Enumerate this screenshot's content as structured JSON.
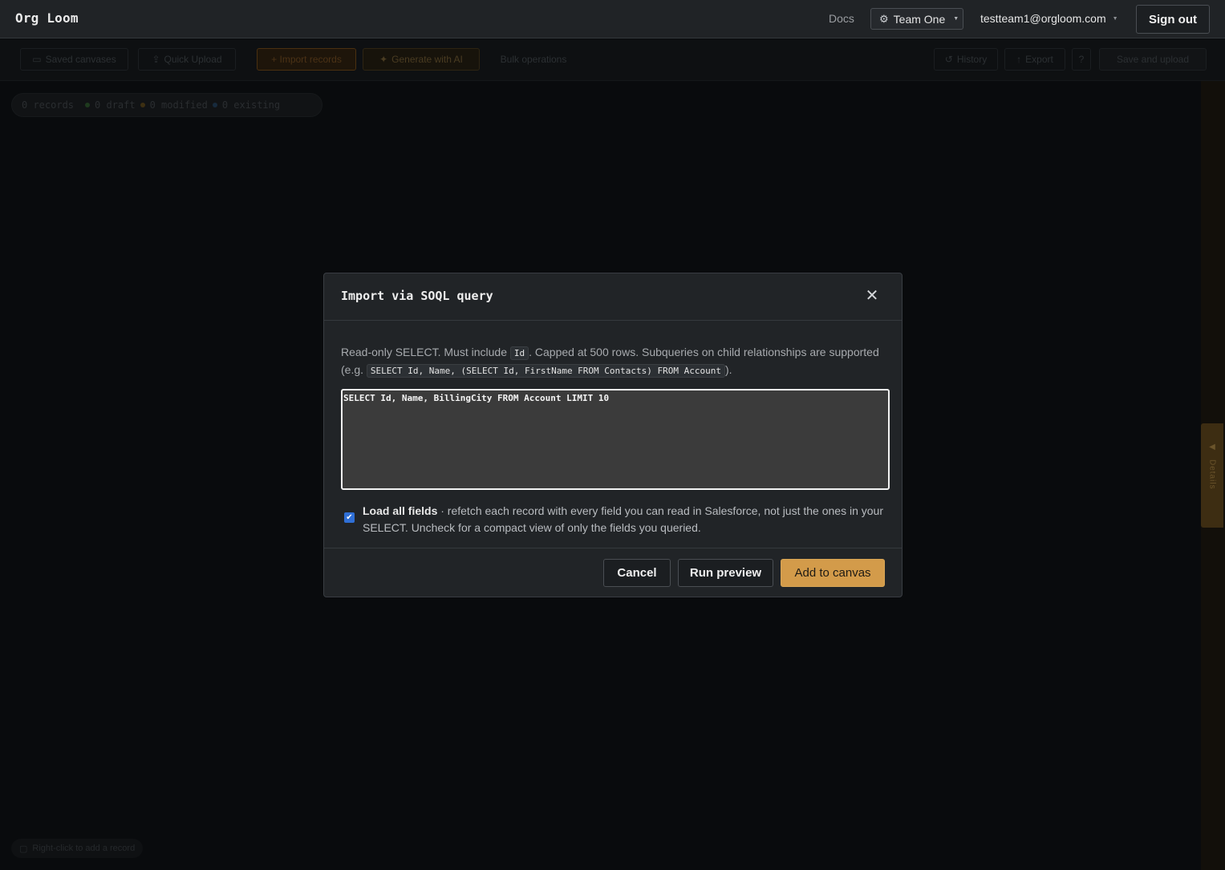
{
  "header": {
    "logo": "Org Loom",
    "docs_label": "Docs",
    "team_label": "Team One",
    "user_email": "testteam1@orgloom.com",
    "sign_out_label": "Sign out"
  },
  "toolbar": {
    "saved_canvases": "Saved canvases",
    "quick_upload": "Quick Upload",
    "import_records": "+ Import records",
    "generate_ai": "Generate with AI",
    "bulk_operations": "Bulk operations",
    "history": "History",
    "export": "Export",
    "help": "?",
    "save_upload": "Save and upload"
  },
  "stats": {
    "records": "0 records",
    "draft": "0 draft",
    "modified": "0 modified",
    "existing": "0 existing"
  },
  "side_panel": {
    "label": "Details"
  },
  "canvas_hint": "Right-click to add a record",
  "modal": {
    "title": "Import via SOQL query",
    "desc_part1": "Read-only SELECT. Must include ",
    "desc_code1": "Id",
    "desc_part2": ". Capped at 500 rows. Subqueries on child relationships are supported (e.g. ",
    "desc_code2": "SELECT Id, Name, (SELECT Id, FirstName FROM Contacts) FROM Account",
    "desc_part3": ").",
    "query_value": "SELECT Id, Name, BillingCity FROM Account LIMIT 10",
    "load_all_label": "Load all fields",
    "load_all_desc": " · refetch each record with every field you can read in Salesforce, not just the ones in your SELECT. Uncheck for a compact view of only the fields you queried.",
    "cancel_label": "Cancel",
    "run_preview_label": "Run preview",
    "add_to_canvas_label": "Add to canvas"
  },
  "colors": {
    "accent": "#d39b4a",
    "checkbox": "#2f6fd6",
    "draft_dot": "#1e3a1e",
    "modified_dot": "#3d2f12",
    "existing_dot": "#172a3d"
  },
  "icons": {
    "team": "gear-icon",
    "close": "close-icon",
    "checkbox": "checkmark-icon"
  }
}
